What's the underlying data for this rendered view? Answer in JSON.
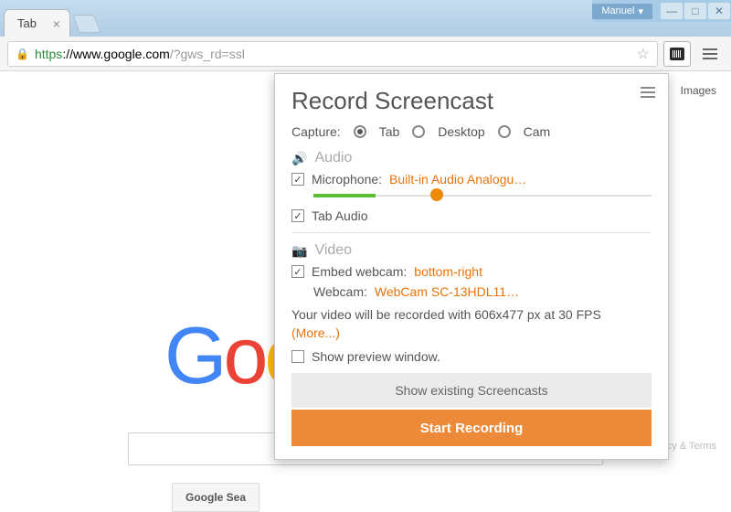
{
  "window": {
    "user": "Manuel",
    "tab_title": "Tab"
  },
  "urlbar": {
    "protocol": "https",
    "domain": "://www.google.com",
    "path": "/?gws_rd=ssl"
  },
  "page": {
    "images": "Images",
    "search_button": "Google Sea",
    "privacy": "Privacy & Terms"
  },
  "popup": {
    "title": "Record Screencast",
    "capture_label": "Capture:",
    "capture_options": {
      "tab": "Tab",
      "desktop": "Desktop",
      "cam": "Cam"
    },
    "audio_section": "Audio",
    "mic_label": "Microphone:",
    "mic_value": "Built-in Audio Analogu…",
    "tab_audio": "Tab Audio",
    "video_section": "Video",
    "embed_label": "Embed webcam:",
    "embed_value": "bottom-right",
    "webcam_label": "Webcam:",
    "webcam_value": "WebCam SC-13HDL11…",
    "info_text": "Your video will be recorded with 606x477 px at 30 FPS ",
    "info_more": "(More...)",
    "preview": "Show preview window.",
    "show_existing": "Show existing Screencasts",
    "start": "Start Recording"
  }
}
